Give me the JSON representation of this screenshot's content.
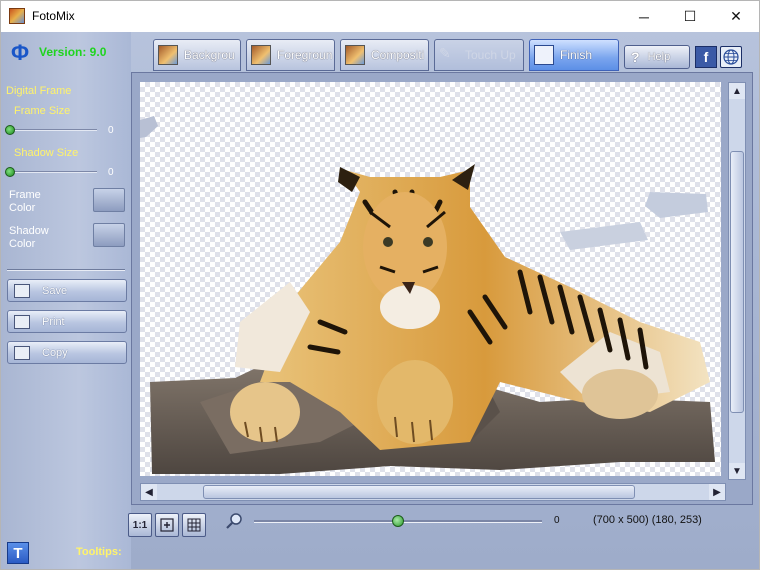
{
  "window": {
    "title": "FotoMix",
    "minimize_glyph": "─",
    "maximize_glyph": "☐",
    "close_glyph": "✕"
  },
  "left_panel": {
    "version": "Version: 9.0",
    "section_title": "Digital Frame",
    "frame_size_label": "Frame Size",
    "frame_size_value": "0",
    "shadow_size_label": "Shadow Size",
    "shadow_size_value": "0",
    "frame_color_line1": "Frame",
    "frame_color_line2": "Color",
    "shadow_color_line1": "Shadow",
    "shadow_color_line2": "Color",
    "save_label": "Save",
    "print_label": "Print",
    "copy_label": "Copy"
  },
  "tabs": [
    {
      "label": "Backgrou"
    },
    {
      "label": "Foregroun"
    },
    {
      "label": "Compositi"
    },
    {
      "label": "Touch Up"
    },
    {
      "label": "Finish"
    }
  ],
  "header": {
    "help_label": "Help",
    "facebook_glyph": "f"
  },
  "bottom": {
    "btn_actual_size": "1:1",
    "zoom_value": "0",
    "dimensions": "(700 x 500) (180, 253)",
    "tooltips_label": "Tooltips:",
    "tooltip_icon_letter": "T"
  },
  "colors": {
    "accent_blue": "#5c8fe6",
    "version_green": "#1fd41f",
    "label_yellow": "#fff36b"
  }
}
